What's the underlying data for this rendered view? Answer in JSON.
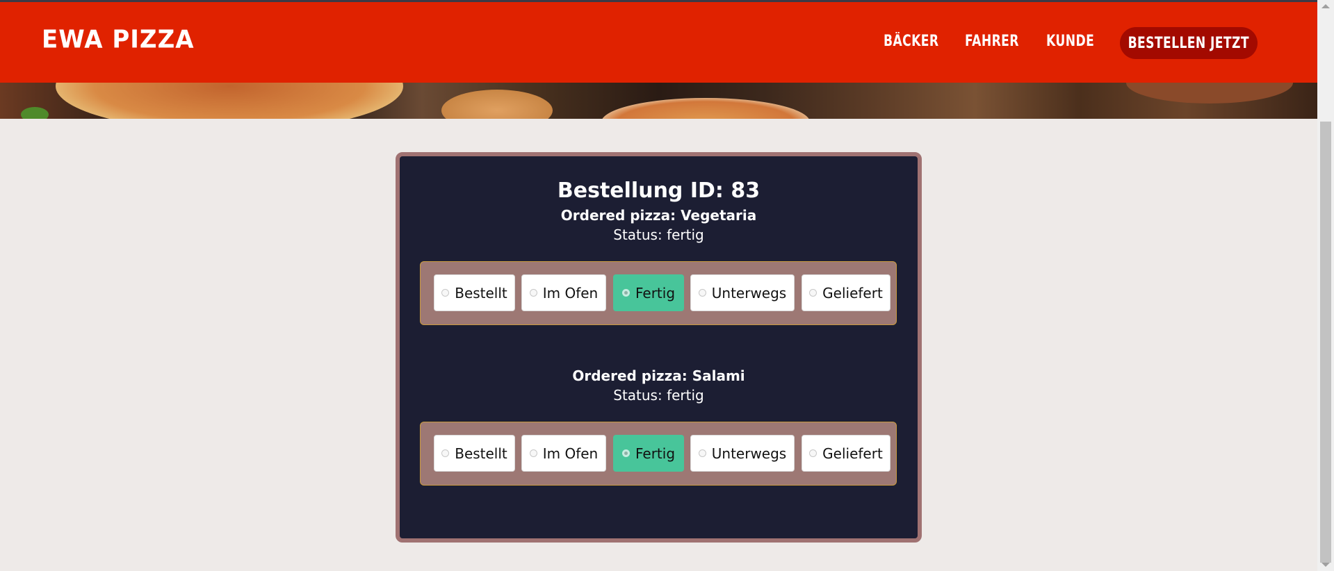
{
  "header": {
    "brand": "EWA PIZZA",
    "nav": [
      "BÄCKER",
      "FAHRER",
      "KUNDE"
    ],
    "cta": "BESTELLEN JETZT"
  },
  "order": {
    "title": "Bestellung ID: 83",
    "items": [
      {
        "pizza": "Ordered pizza: Vegetaria",
        "status": "Status: fertig",
        "options": [
          "Bestellt",
          "Im Ofen",
          "Fertig",
          "Unterwegs",
          "Geliefert"
        ],
        "selected": "Fertig"
      },
      {
        "pizza": "Ordered pizza: Salami",
        "status": "Status: fertig",
        "options": [
          "Bestellt",
          "Im Ofen",
          "Fertig",
          "Unterwegs",
          "Geliefert"
        ],
        "selected": "Fertig"
      }
    ]
  },
  "colors": {
    "nav_bg": "#e02200",
    "cta_bg": "#a30a00",
    "card_bg": "#1c1e33",
    "card_border": "#a07272",
    "selected_option": "#48c59a"
  }
}
